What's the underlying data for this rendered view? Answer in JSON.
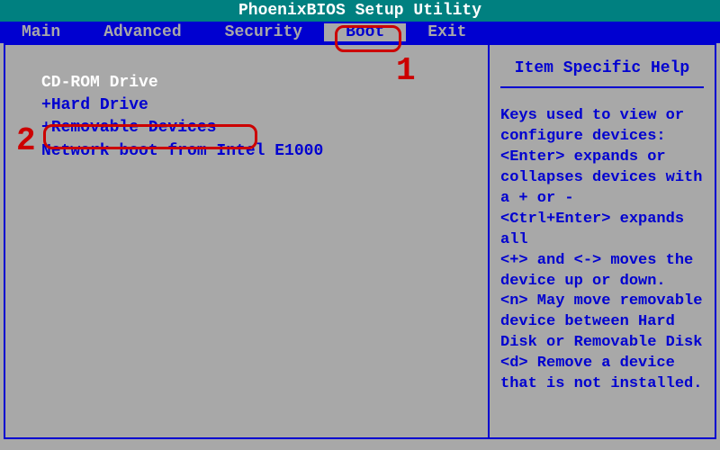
{
  "title": "PhoenixBIOS Setup Utility",
  "menu": {
    "items": [
      "Main",
      "Advanced",
      "Security",
      "Boot",
      "Exit"
    ],
    "active_index": 3
  },
  "boot_order": {
    "items": [
      {
        "prefix": "",
        "label": "CD-ROM Drive",
        "selected": true
      },
      {
        "prefix": "+",
        "label": "Hard Drive",
        "selected": false
      },
      {
        "prefix": "+",
        "label": "Removable Devices",
        "selected": false
      },
      {
        "prefix": "",
        "label": "Network boot from Intel E1000",
        "selected": false
      }
    ]
  },
  "help_panel": {
    "title": "Item Specific Help",
    "lines": [
      "Keys used to view or",
      "configure devices:",
      "<Enter> expands or",
      "collapses devices with",
      "a + or -",
      "<Ctrl+Enter> expands",
      "all",
      "<+> and <-> moves the",
      "device up or down.",
      "<n> May move removable",
      "device between Hard",
      "Disk or Removable Disk",
      "<d> Remove a device",
      "that is not installed."
    ]
  },
  "annotations": {
    "label_1": "1",
    "label_2": "2"
  }
}
